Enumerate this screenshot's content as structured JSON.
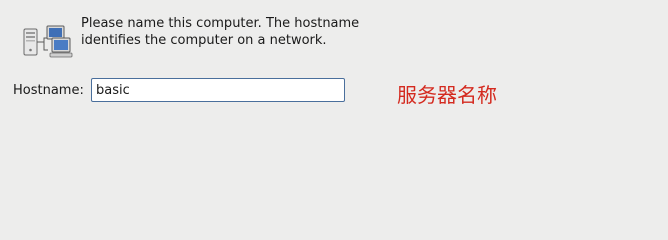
{
  "description": "Please name this computer.  The hostname identifies the computer on a network.",
  "hostname": {
    "label": "Hostname:",
    "value": "basic"
  },
  "annotation": {
    "text": "服务器名称",
    "color": "#d42a1f"
  },
  "icon": "network-computers-icon"
}
